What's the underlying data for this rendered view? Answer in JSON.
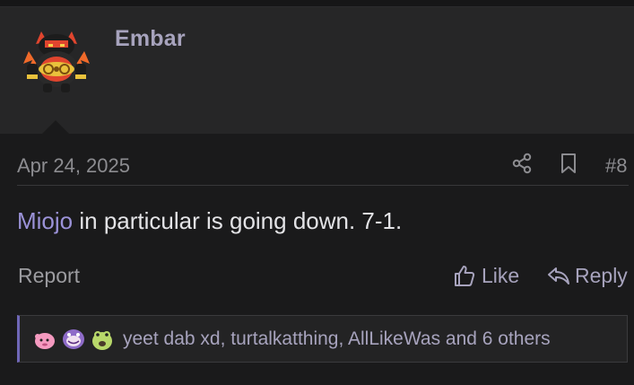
{
  "post": {
    "username": "Embar",
    "date": "Apr 24, 2025",
    "post_number": "#8",
    "mention": "Miojo",
    "message_rest": " in particular is going down. 7-1.",
    "report_label": "Report",
    "like_label": "Like",
    "reply_label": "Reply",
    "reactions_text": "yeet dab xd, turtalkatthing, AllLikeWas and 6 others"
  },
  "icons": {
    "avatar": "emboar-sprite",
    "share": "share-icon",
    "bookmark": "bookmark-icon",
    "like": "thumbs-up-icon",
    "reply": "reply-arrow-icon",
    "reactions": [
      "pink-blob-reaction-icon",
      "purple-face-reaction-icon",
      "green-frog-reaction-icon"
    ]
  },
  "colors": {
    "accent": "#9b92d8",
    "username": "#a7a3bd",
    "reactions_border": "#6f67b8"
  }
}
